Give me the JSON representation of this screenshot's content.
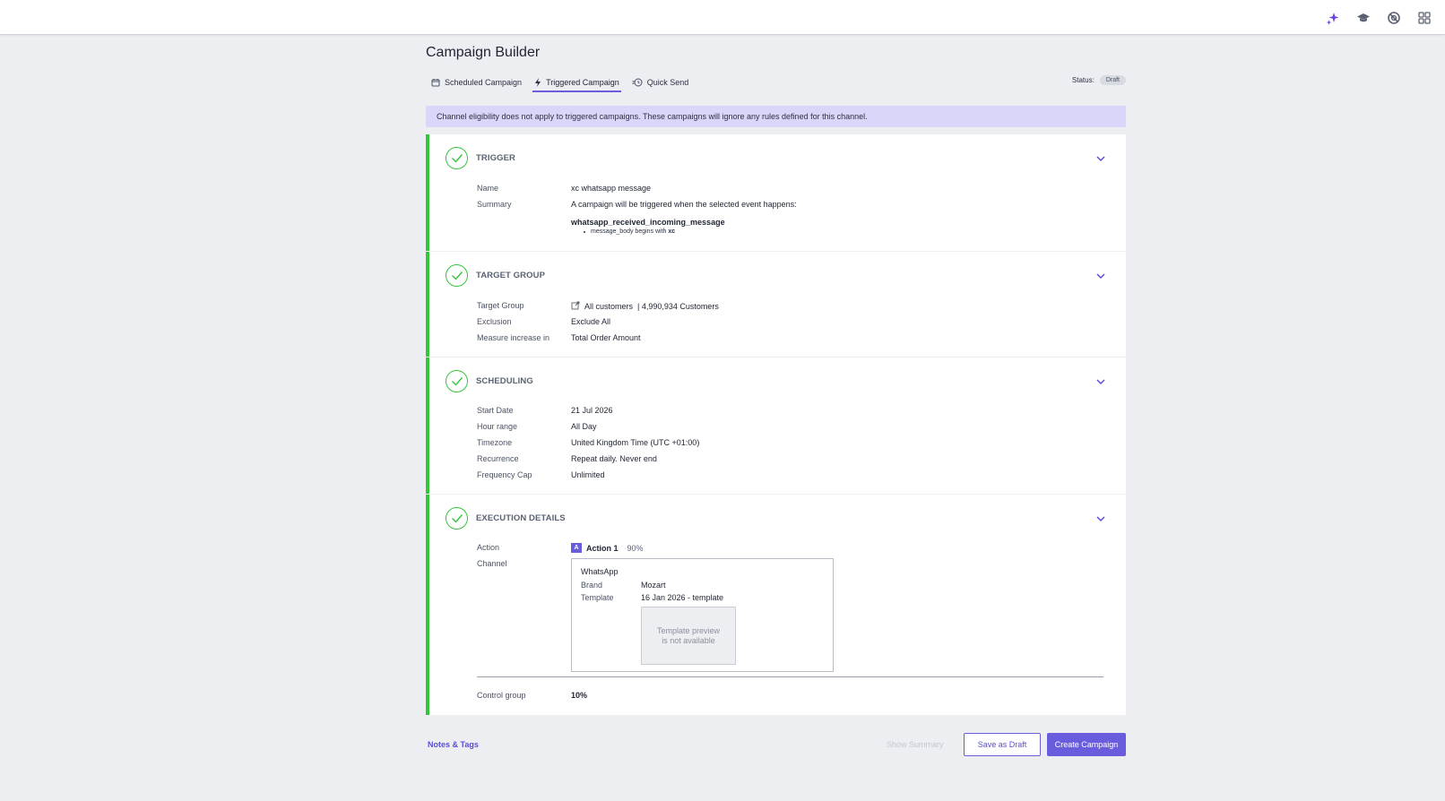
{
  "header": {
    "icons": [
      "sparkle-icon",
      "graduation-cap-icon",
      "help-icon",
      "apps-grid-icon"
    ]
  },
  "page": {
    "title": "Campaign Builder",
    "tabs": [
      {
        "label": "Scheduled Campaign",
        "icon": "calendar-icon",
        "active": false
      },
      {
        "label": "Triggered Campaign",
        "icon": "lightning-icon",
        "active": true
      },
      {
        "label": "Quick Send",
        "icon": "clock-icon",
        "active": false
      }
    ],
    "status_label": "Status:",
    "status_value": "Draft"
  },
  "banner": "Channel eligibility does not apply to triggered campaigns. These campaigns will ignore any rules defined for this channel.",
  "colors": {
    "accent": "#6a5ddd",
    "success": "#35c53b",
    "banner_bg": "#d9d6fa"
  },
  "trigger": {
    "title": "TRIGGER",
    "name_label": "Name",
    "name_value": "xc whatsapp message",
    "summary_label": "Summary",
    "summary_value": "A campaign will be triggered when the selected event happens:",
    "event": "whatsapp_received_incoming_message",
    "condition_field": "message_body begins with ",
    "condition_value": "xc"
  },
  "target_group": {
    "title": "TARGET GROUP",
    "target_label": "Target Group",
    "target_value": "All customers",
    "target_count": "| 4,990,934 Customers",
    "exclusion_label": "Exclusion",
    "exclusion_value": "Exclude All",
    "measure_label": "Measure increase in",
    "measure_value": "Total Order Amount"
  },
  "scheduling": {
    "title": "SCHEDULING",
    "start_label": "Start Date",
    "start_value": "21 Jul 2026",
    "hour_label": "Hour range",
    "hour_value": "All Day",
    "tz_label": "Timezone",
    "tz_value": "United Kingdom Time (UTC +01:00)",
    "recurrence_label": "Recurrence",
    "recurrence_value": "Repeat daily. Never end",
    "freq_label": "Frequency Cap",
    "freq_value": "Unlimited"
  },
  "execution": {
    "title": "EXECUTION DETAILS",
    "action_label": "Action",
    "action_badge": "A",
    "action_name": "Action 1",
    "action_pct": "90%",
    "channel_label": "Channel",
    "channel_name": "WhatsApp",
    "brand_label": "Brand",
    "brand_value": "Mozart",
    "template_label": "Template",
    "template_value": "16 Jan 2026 - template",
    "preview_line1": "Template preview",
    "preview_line2": "is not available",
    "control_label": "Control group",
    "control_value": "10%"
  },
  "footer": {
    "notes_link": "Notes & Tags",
    "show_summary": "Show Summary",
    "save_draft": "Save as Draft",
    "create": "Create Campaign"
  }
}
